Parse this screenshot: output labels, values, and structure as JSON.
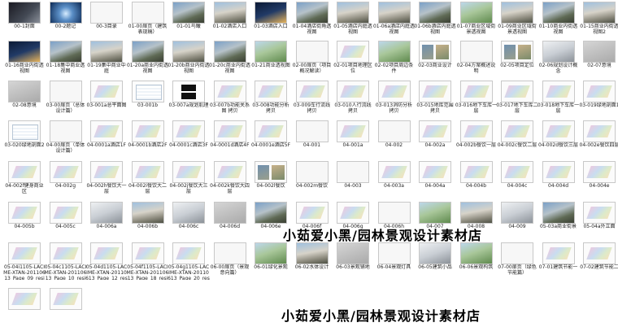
{
  "rows": [
    [
      {
        "label": "00-1封面",
        "style": "t-dark"
      },
      {
        "label": "00-2题记",
        "style": "t-blue"
      },
      {
        "label": "00-3目录",
        "style": "t-white"
      },
      {
        "label": "01-00扉页（建筑表现稿）",
        "style": "t-white"
      },
      {
        "label": "01-01鸟瞰",
        "style": "t-photo"
      },
      {
        "label": "01-02酒店入口",
        "style": "t-photo2"
      },
      {
        "label": "01-03酒店入口",
        "style": "t-night"
      },
      {
        "label": "01-04酒店街角透视图",
        "style": "t-photo"
      },
      {
        "label": "01-05酒店内庭透视图",
        "style": "t-photo2"
      },
      {
        "label": "01-06a酒店内庭透视图",
        "style": "t-photo2"
      },
      {
        "label": "01-06b酒店内庭透视图",
        "style": "t-photo"
      },
      {
        "label": "01-07商业区域街景透视图",
        "style": "t-green"
      },
      {
        "label": "01-09商业区域街景透视图",
        "style": "t-photo2"
      },
      {
        "label": "01-10商业内街透视图",
        "style": "t-photo"
      },
      {
        "label": "01-15商业内街透视图2",
        "style": "t-photo2"
      }
    ],
    [
      {
        "label": "01-16商业内街透视图",
        "style": "t-night"
      },
      {
        "label": "01-18集中商业透视图",
        "style": "t-photo"
      },
      {
        "label": "01-19集中商业中庭",
        "style": "t-photo2"
      },
      {
        "label": "01-20a商业内街透视图",
        "style": "t-photo"
      },
      {
        "label": "01-20b商业内街透视图",
        "style": "t-photo2"
      },
      {
        "label": "01-20c商业内街透视图",
        "style": "t-photo"
      },
      {
        "label": "01-21商业透视图",
        "style": "t-green"
      },
      {
        "label": "02-00扉页（项目概况解读）",
        "style": "t-white"
      },
      {
        "label": "02-01项目地理区位",
        "style": "t-plan"
      },
      {
        "label": "02-02项目周边条件",
        "style": "t-green"
      },
      {
        "label": "02-03商业设计",
        "style": "t-mix"
      },
      {
        "label": "02-04方案概述说明",
        "style": "t-white"
      },
      {
        "label": "02-05项目定位",
        "style": "t-mix"
      },
      {
        "label": "02-06规划设计概念",
        "style": "t-build"
      },
      {
        "label": "02-07意境",
        "style": "t-grey"
      }
    ],
    [
      {
        "label": "02-08意境",
        "style": "t-grey"
      },
      {
        "label": "03-00扉页（总体设计篇）",
        "style": "t-white"
      },
      {
        "label": "03-001a总平面图",
        "style": "t-plan"
      },
      {
        "label": "03-001b",
        "style": "t-layout"
      },
      {
        "label": "03-007a规划肌理",
        "style": "t-logo"
      },
      {
        "label": "03-007b功能关系图 拷贝",
        "style": "t-plan"
      },
      {
        "label": "03-008功能分析 拷贝",
        "style": "t-plan"
      },
      {
        "label": "03-009车行流线 拷贝",
        "style": "t-plan"
      },
      {
        "label": "03-010人行流线 拷贝",
        "style": "t-plan"
      },
      {
        "label": "03-013消防分析 拷贝",
        "style": "t-plan"
      },
      {
        "label": "03-015地库范围 拷贝",
        "style": "t-plan"
      },
      {
        "label": "03-016地下车库一层",
        "style": "t-plan"
      },
      {
        "label": "03-017地下车库二层",
        "style": "t-plan"
      },
      {
        "label": "03-018地下车库一层",
        "style": "t-plan"
      },
      {
        "label": "03-019绿地剖面1",
        "style": "t-plan"
      }
    ],
    [
      {
        "label": "03-020绿地剖面2",
        "style": "t-layout"
      },
      {
        "label": "04-00扉页（单体设计篇）",
        "style": "t-white"
      },
      {
        "label": "04-0001a酒店1F",
        "style": "t-plan"
      },
      {
        "label": "04-0001b酒店2F",
        "style": "t-plan"
      },
      {
        "label": "04-0001c酒店3F",
        "style": "t-plan"
      },
      {
        "label": "04-0001d酒店4F",
        "style": "t-plan"
      },
      {
        "label": "04-0001e酒店5F",
        "style": "t-plan"
      },
      {
        "label": "04-001",
        "style": "t-white"
      },
      {
        "label": "04-001a",
        "style": "t-plan"
      },
      {
        "label": "04-002",
        "style": "t-white"
      },
      {
        "label": "04-002a",
        "style": "t-plan"
      },
      {
        "label": "04-002b餐饮一层",
        "style": "t-plan"
      },
      {
        "label": "04-002c餐饮二层",
        "style": "t-plan"
      },
      {
        "label": "04-002d餐饮三层",
        "style": "t-plan"
      },
      {
        "label": "04-002e餐饮四层",
        "style": "t-plan"
      }
    ],
    [
      {
        "label": "04-002f健身商业区",
        "style": "t-plan"
      },
      {
        "label": "04-002g",
        "style": "t-plan"
      },
      {
        "label": "04-002h餐饮大一层",
        "style": "t-plan"
      },
      {
        "label": "04-002i餐饮大二层",
        "style": "t-plan"
      },
      {
        "label": "04-002j餐饮大三层",
        "style": "t-plan"
      },
      {
        "label": "04-002k餐饮大四层",
        "style": "t-plan"
      },
      {
        "label": "04-002l餐饮",
        "style": "t-mix"
      },
      {
        "label": "04-002m餐饮",
        "style": "t-white"
      },
      {
        "label": "04-003",
        "style": "t-white"
      },
      {
        "label": "04-003a",
        "style": "t-plan"
      },
      {
        "label": "04-004a",
        "style": "t-plan"
      },
      {
        "label": "04-004b",
        "style": "t-plan"
      },
      {
        "label": "04-004c",
        "style": "t-plan"
      },
      {
        "label": "04-004d",
        "style": "t-plan"
      },
      {
        "label": "04-004e",
        "style": "t-plan"
      }
    ],
    [
      {
        "label": "04-005b",
        "style": "t-plan"
      },
      {
        "label": "04-005c",
        "style": "t-plan"
      },
      {
        "label": "04-006a",
        "style": "t-build"
      },
      {
        "label": "04-006b",
        "style": "t-photo2"
      },
      {
        "label": "04-006c",
        "style": "t-build"
      },
      {
        "label": "04-006d",
        "style": "t-grey"
      },
      {
        "label": "04-006e",
        "style": "t-photo"
      },
      {
        "label": "04-006f",
        "style": "t-plan"
      },
      {
        "label": "04-006g",
        "style": "t-plan"
      },
      {
        "label": "04-006h",
        "style": "t-white"
      },
      {
        "label": "04-007",
        "style": "t-green"
      },
      {
        "label": "04-008",
        "style": "t-photo2"
      },
      {
        "label": "04-009",
        "style": "t-build"
      },
      {
        "label": "05-03a商业街景",
        "style": "t-photo"
      },
      {
        "label": "05-04a外立面",
        "style": "t-plan"
      }
    ],
    [
      {
        "label": "05-04i1105-LACIME-XTAN-20110613_Page_09_resize",
        "style": "t-plan"
      },
      {
        "label": "05-04c1105-LACIME-XTAN-20110613_Page_10_resize",
        "style": "t-plan"
      },
      {
        "label": "05-04d1105-LACIME-XTAN-20110613_Page_12_resize",
        "style": "t-plan"
      },
      {
        "label": "05-04f1105-LACIME-XTAN-20110613_Page_18_resize",
        "style": "t-plan"
      },
      {
        "label": "05-04g1105-LACIME-XTAN-20110613_Page_20_resize",
        "style": "t-plan"
      },
      {
        "label": "06-00扉页（景观意向篇）",
        "style": "t-white"
      },
      {
        "label": "06-01绿化景观",
        "style": "t-green"
      },
      {
        "label": "06-02水体设计",
        "style": "t-photo2"
      },
      {
        "label": "06-03景观铺地",
        "style": "t-grey"
      },
      {
        "label": "06-04景观灯具",
        "style": "t-white"
      },
      {
        "label": "06-05建筑小品",
        "style": "t-build"
      },
      {
        "label": "06-06景观构筑",
        "style": "t-green"
      },
      {
        "label": "07-00扉页（绿色节能篇）",
        "style": "t-white"
      },
      {
        "label": "07-01建筑节能一",
        "style": "t-plan"
      },
      {
        "label": "07-02建筑节能二",
        "style": "t-plan"
      }
    ],
    [
      {
        "label": "",
        "style": "t-plan"
      },
      {
        "label": "",
        "style": "t-plan"
      }
    ]
  ],
  "watermark": "小茹爱小黑/园林景观设计素材店",
  "watermark_repeat": "小茹爱小黑/园林景观设计素材店"
}
